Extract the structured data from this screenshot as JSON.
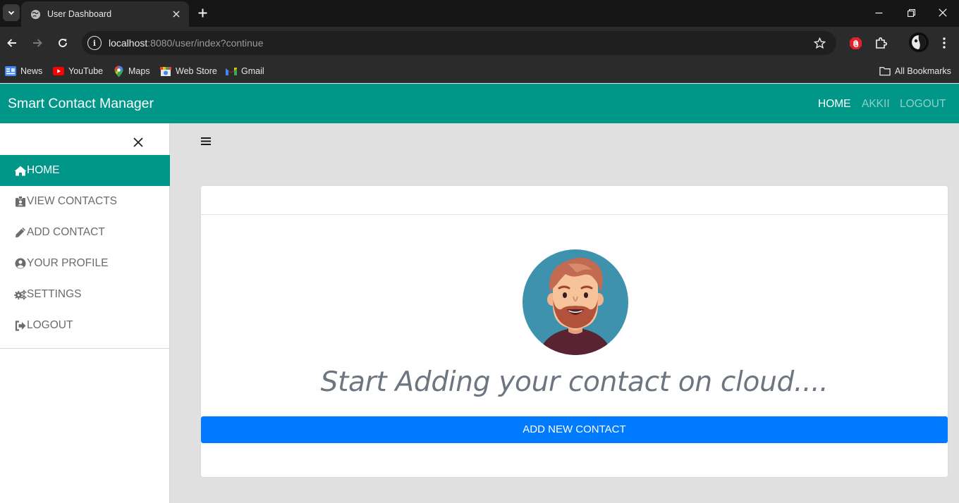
{
  "browser": {
    "tab_title": "User Dashboard",
    "url_host": "localhost",
    "url_rest": ":8080/user/index?continue",
    "bookmarks": [
      {
        "label": "News",
        "icon": "google-news-icon"
      },
      {
        "label": "YouTube",
        "icon": "youtube-icon"
      },
      {
        "label": "Maps",
        "icon": "maps-icon"
      },
      {
        "label": "Web Store",
        "icon": "web-store-icon"
      },
      {
        "label": "Gmail",
        "icon": "gmail-icon"
      }
    ],
    "all_bookmarks": "All Bookmarks"
  },
  "app": {
    "brand": "Smart Contact Manager",
    "nav": {
      "home": "HOME",
      "user": "AKKII",
      "logout": "LOGOUT"
    },
    "sidebar": {
      "items": [
        {
          "label": "HOME",
          "icon": "home-icon"
        },
        {
          "label": "VIEW CONTACTS",
          "icon": "contact-card-icon"
        },
        {
          "label": "ADD CONTACT",
          "icon": "pencil-icon"
        },
        {
          "label": "YOUR PROFILE",
          "icon": "user-circle-icon"
        },
        {
          "label": "SETTINGS",
          "icon": "gears-icon"
        },
        {
          "label": "LOGOUT",
          "icon": "sign-out-icon"
        }
      ]
    },
    "main": {
      "tagline": "Start Adding your contact on cloud....",
      "add_button": "ADD NEW CONTACT"
    }
  },
  "colors": {
    "brand_teal": "#009688",
    "primary_blue": "#007bff",
    "page_bg": "#e0e0e0"
  }
}
